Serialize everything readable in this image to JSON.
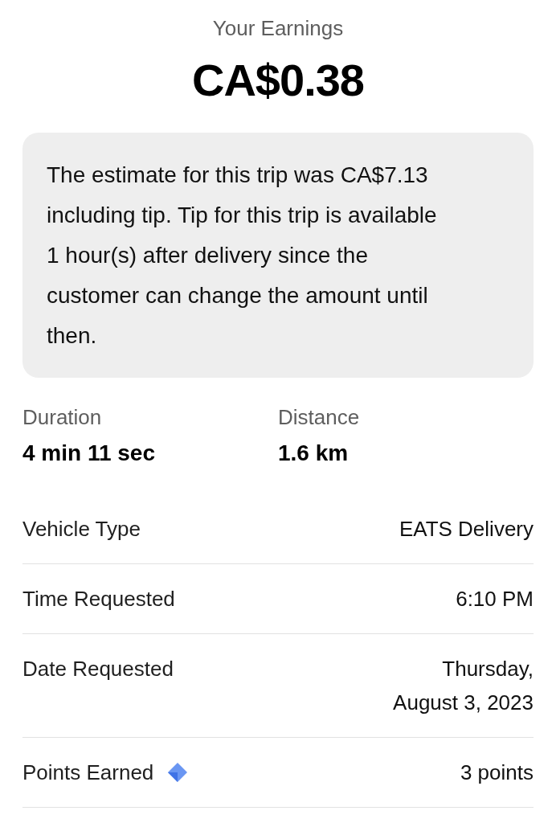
{
  "header": {
    "title": "Your Earnings",
    "amount": "CA$0.38"
  },
  "notice": {
    "text": "The estimate for this trip was CA$7.13 including tip. Tip for this trip is available 1 hour(s) after delivery since the customer can change the amount until then."
  },
  "stats": [
    {
      "label": "Duration",
      "value": "4 min 11 sec"
    },
    {
      "label": "Distance",
      "value": "1.6 km"
    }
  ],
  "details": [
    {
      "kind": "plain",
      "label": "Vehicle Type",
      "value": "EATS Delivery"
    },
    {
      "kind": "plain",
      "label": "Time Requested",
      "value": "6:10 PM"
    },
    {
      "kind": "plain",
      "label": "Date Requested",
      "value": "Thursday, August 3, 2023"
    },
    {
      "kind": "points",
      "label": "Points Earned",
      "value": "3 points"
    }
  ]
}
